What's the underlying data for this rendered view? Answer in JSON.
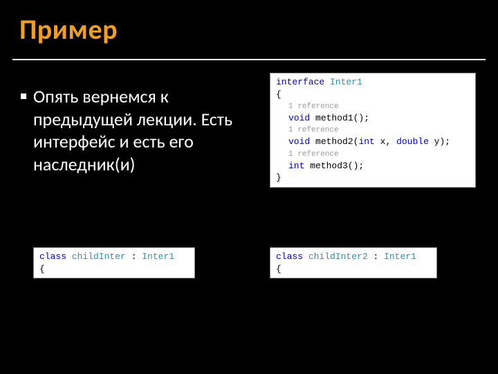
{
  "title": "Пример",
  "bullet_text": "Опять вернемся к предыдущей лекции. Есть интерфейс и есть его наследник(и)",
  "code_interface": {
    "l1_kw": "interface",
    "l1_type": "Inter1",
    "brace_open": "{",
    "ref": "1 reference",
    "m1_kw": "void",
    "m1_rest": " method1();",
    "m2_kw": "void",
    "m2_rest": " method2(",
    "m2_p1_kw": "int",
    "m2_p1_rest": " x, ",
    "m2_p2_kw": "double",
    "m2_p2_rest": " y);",
    "m3_kw": "int",
    "m3_rest": " method3();",
    "brace_close": "}"
  },
  "code_child1": {
    "l1_kw": "class",
    "l1_type": "childInter",
    "l1_colon": " : ",
    "l1_base": "Inter1",
    "brace_open": "{"
  },
  "code_child2": {
    "l1_kw": "class",
    "l1_type": "childInter2",
    "l1_colon": " : ",
    "l1_base": "Inter1",
    "brace_open": "{"
  }
}
